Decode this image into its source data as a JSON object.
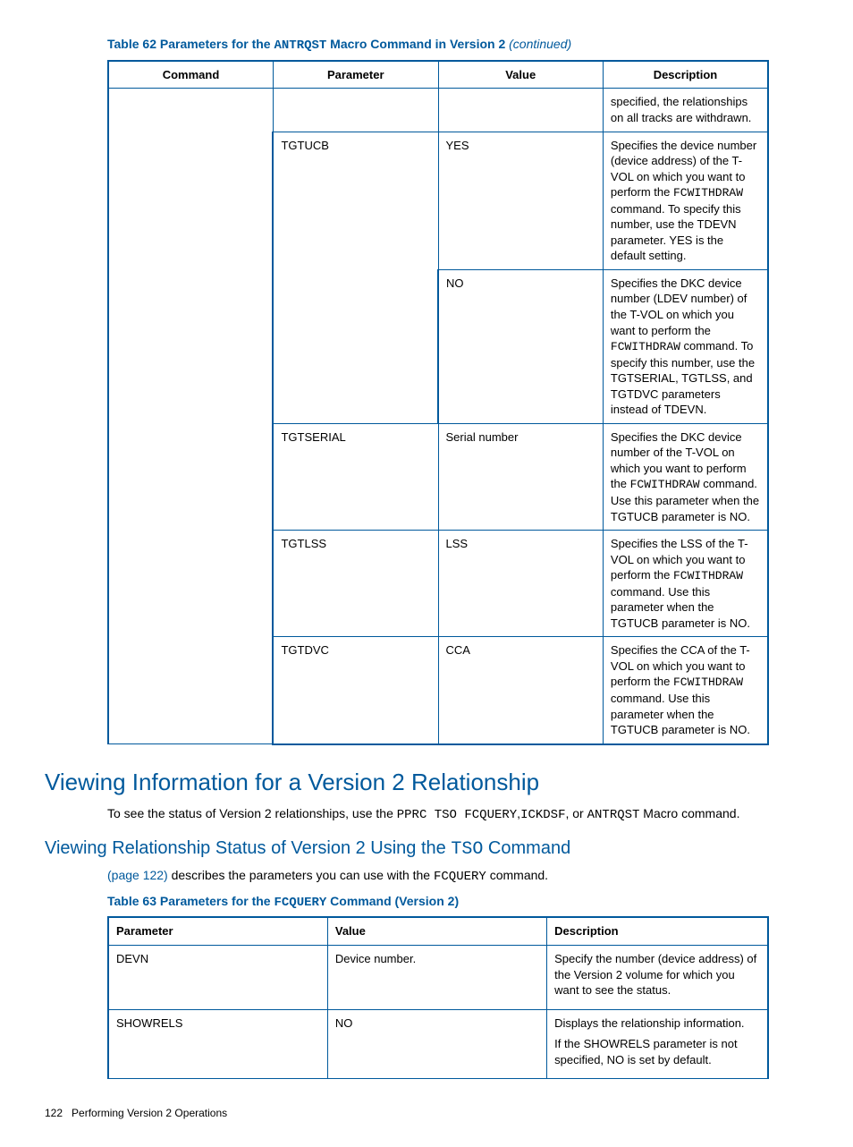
{
  "table62": {
    "caption_prefix": "Table 62 Parameters for the ",
    "caption_code": "ANTRQST",
    "caption_suffix": " Macro Command in Version 2 ",
    "caption_cont": "(continued)",
    "headers": {
      "c1": "Command",
      "c2": "Parameter",
      "c3": "Value",
      "c4": "Description"
    },
    "rows": [
      {
        "para": "",
        "value": "",
        "desc_plain": "specified, the relationships on all tracks are withdrawn."
      },
      {
        "para": "TGTUCB",
        "value": "YES",
        "desc_parts": [
          "Specifies the device number (device address) of the T-VOL on which you want to perform the ",
          {
            "code": "FCWITHDRAW"
          },
          " command. To specify this number, use the TDEVN parameter. YES is the default setting."
        ]
      },
      {
        "para": "",
        "value": "NO",
        "desc_parts": [
          "Specifies the DKC device number (LDEV number) of the T-VOL on which you want to perform the ",
          {
            "code": "FCWITHDRAW"
          },
          " command. To specify this number, use the TGTSERIAL, TGTLSS, and TGTDVC parameters instead of TDEVN."
        ]
      },
      {
        "para": "TGTSERIAL",
        "value": "Serial number",
        "desc_parts": [
          "Specifies the DKC device number of the T-VOL on which you want to perform the ",
          {
            "code": "FCWITHDRAW"
          },
          " command. Use this parameter when the TGTUCB parameter is NO."
        ]
      },
      {
        "para": "TGTLSS",
        "value": "LSS",
        "desc_parts": [
          "Specifies the LSS of the T-VOL on which you want to perform the ",
          {
            "code": "FCWITHDRAW"
          },
          " command. Use this parameter when the TGTUCB parameter is NO."
        ]
      },
      {
        "para": "TGTDVC",
        "value": "CCA",
        "desc_parts": [
          "Specifies the CCA of the T-VOL on which you want to perform the ",
          {
            "code": "FCWITHDRAW"
          },
          " command. Use this parameter when the TGTUCB parameter is NO."
        ]
      }
    ]
  },
  "section1": {
    "heading": "Viewing Information for a Version 2 Relationship",
    "para_parts": [
      "To see the status of Version 2 relationships, use the ",
      {
        "code": "PPRC TSO FCQUERY"
      },
      ",",
      {
        "code": "ICKDSF"
      },
      ", or ",
      {
        "code": "ANTRQST"
      },
      " Macro command."
    ]
  },
  "section2": {
    "heading_prefix": "Viewing Relationship Status of Version 2 Using the ",
    "heading_code": "TSO",
    "heading_suffix": " Command",
    "para_link": "(page 122)",
    "para_mid": " describes the parameters you can use with the ",
    "para_code": "FCQUERY",
    "para_end": " command."
  },
  "table63": {
    "caption_prefix": "Table 63 Parameters for the ",
    "caption_code": "FCQUERY",
    "caption_suffix": " Command (Version 2)",
    "headers": {
      "c1": "Parameter",
      "c2": "Value",
      "c3": "Description"
    },
    "rows": [
      {
        "para": "DEVN",
        "value": "Device number.",
        "desc_lines": [
          "Specify the number (device address) of the Version 2 volume for which you want to see the status."
        ]
      },
      {
        "para": "SHOWRELS",
        "value": "NO",
        "desc_lines": [
          "Displays the relationship information.",
          "If the SHOWRELS parameter is not specified, NO is set by default."
        ]
      }
    ]
  },
  "footer": {
    "page": "122",
    "title": "Performing Version 2 Operations"
  }
}
